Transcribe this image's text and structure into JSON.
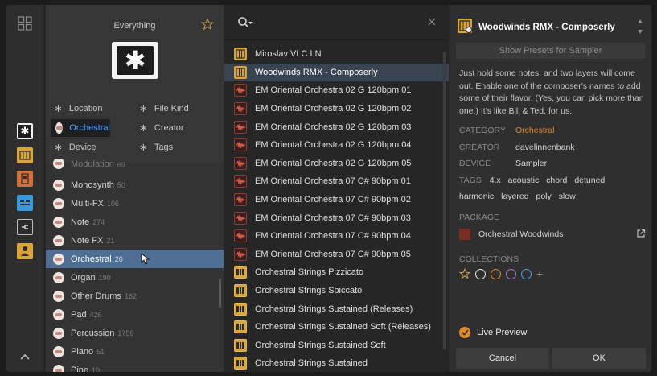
{
  "filter": {
    "header": "Everything",
    "chips": [
      {
        "label": "Location",
        "selected": false
      },
      {
        "label": "File Kind",
        "selected": false
      },
      {
        "label": "Orchestral",
        "selected": true
      },
      {
        "label": "Creator",
        "selected": false
      },
      {
        "label": "Device",
        "selected": false
      },
      {
        "label": "Tags",
        "selected": false
      }
    ],
    "categories": [
      {
        "label": "Modulation",
        "count": "69"
      },
      {
        "label": "Monosynth",
        "count": "50"
      },
      {
        "label": "Multi-FX",
        "count": "106"
      },
      {
        "label": "Note",
        "count": "274"
      },
      {
        "label": "Note FX",
        "count": "21"
      },
      {
        "label": "Orchestral",
        "count": "20"
      },
      {
        "label": "Organ",
        "count": "190"
      },
      {
        "label": "Other Drums",
        "count": "162"
      },
      {
        "label": "Pad",
        "count": "426"
      },
      {
        "label": "Percussion",
        "count": "1759"
      },
      {
        "label": "Piano",
        "count": "51"
      },
      {
        "label": "Pipe",
        "count": "10"
      }
    ]
  },
  "results": {
    "items": [
      {
        "label": "Miroslav VLC LN",
        "icon": "instrument-icon"
      },
      {
        "label": "Woodwinds RMX - Composerly",
        "icon": "instrument-icon"
      },
      {
        "label": "EM Oriental Orchestra 02 G 120bpm 01",
        "icon": "audio-clip-icon"
      },
      {
        "label": "EM Oriental Orchestra 02 G 120bpm 02",
        "icon": "audio-clip-icon"
      },
      {
        "label": "EM Oriental Orchestra 02 G 120bpm 03",
        "icon": "audio-clip-icon"
      },
      {
        "label": "EM Oriental Orchestra 02 G 120bpm 04",
        "icon": "audio-clip-icon"
      },
      {
        "label": "EM Oriental Orchestra 02 G 120bpm 05",
        "icon": "audio-clip-icon"
      },
      {
        "label": "EM Oriental Orchestra 07 C# 90bpm 01",
        "icon": "audio-clip-icon"
      },
      {
        "label": "EM Oriental Orchestra 07 C# 90bpm 02",
        "icon": "audio-clip-icon"
      },
      {
        "label": "EM Oriental Orchestra 07 C# 90bpm 03",
        "icon": "audio-clip-icon"
      },
      {
        "label": "EM Oriental Orchestra 07 C# 90bpm 04",
        "icon": "audio-clip-icon"
      },
      {
        "label": "EM Oriental Orchestra 07 C# 90bpm 05",
        "icon": "audio-clip-icon"
      },
      {
        "label": "Orchestral Strings Pizzicato",
        "icon": "preset-icon"
      },
      {
        "label": "Orchestral Strings Spiccato",
        "icon": "preset-icon"
      },
      {
        "label": "Orchestral Strings Sustained (Releases)",
        "icon": "preset-icon"
      },
      {
        "label": "Orchestral Strings Sustained Soft (Releases)",
        "icon": "preset-icon"
      },
      {
        "label": "Orchestral Strings Sustained Soft",
        "icon": "preset-icon"
      },
      {
        "label": "Orchestral Strings Sustained",
        "icon": "preset-icon"
      }
    ]
  },
  "info": {
    "title": "Woodwinds RMX - Composerly",
    "show_presets": "Show Presets for Sampler",
    "description": "Just hold some notes, and two layers will come out. Enable one of the composer's names to add some of their flavor. (Yes, you can pick more than one.) It's like Bill & Ted, for us.",
    "category_label": "CATEGORY",
    "category_value": "Orchestral",
    "creator_label": "CREATOR",
    "creator_value": "davelinnenbank",
    "device_label": "DEVICE",
    "device_value": "Sampler",
    "tags_label": "TAGS",
    "tags": [
      "4.x",
      "acoustic",
      "chord",
      "detuned",
      "harmonic",
      "layered",
      "poly",
      "slow"
    ],
    "package_label": "PACKAGE",
    "package_value": "Orchestral Woodwinds",
    "collections_label": "COLLECTIONS",
    "live_preview": "Live Preview",
    "cancel": "Cancel",
    "ok": "OK"
  },
  "colors": {
    "accent_orange": "#e08a2c",
    "selection_blue": "#4f6e94",
    "link_blue": "#4da3ff"
  }
}
